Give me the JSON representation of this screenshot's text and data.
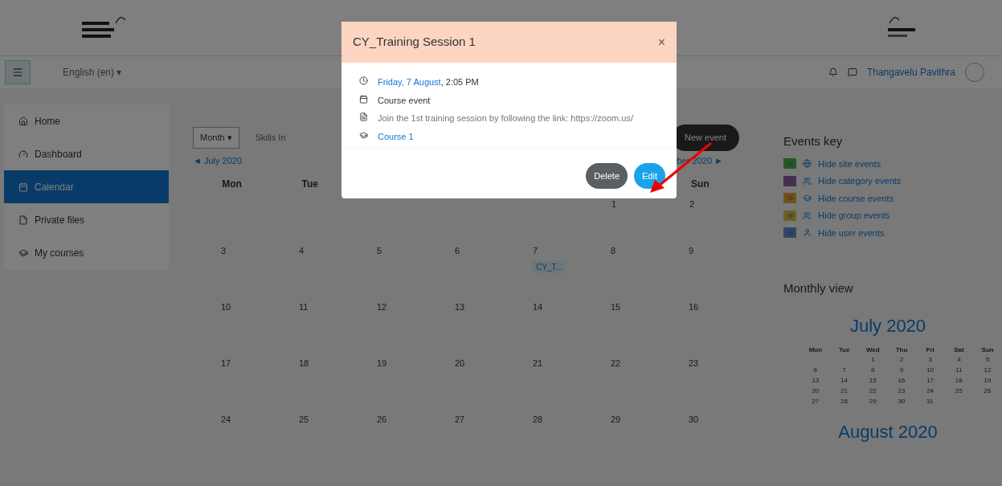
{
  "header": {
    "language": "English (en) ▾",
    "user_name": "Thangavelu Pavithra"
  },
  "sidebar": {
    "items": [
      {
        "label": "Home",
        "selected": false
      },
      {
        "label": "Dashboard",
        "selected": false
      },
      {
        "label": "Calendar",
        "selected": true
      },
      {
        "label": "Private files",
        "selected": false
      },
      {
        "label": "My courses",
        "selected": false
      }
    ]
  },
  "calendar": {
    "view_select": "Month ▾",
    "course_select": "Skills In",
    "prev_arrow": "◄",
    "prev_month": "July 2020",
    "next_month": "ber 2020",
    "next_arrow": "►",
    "new_event": "New event",
    "weekdays_left": [
      "Mon",
      "Tue"
    ],
    "weekdays_right": [
      "Sun"
    ],
    "weeks": [
      {
        "days": [
          {
            "day": "1"
          },
          {
            "day": "2"
          }
        ]
      },
      {
        "days": [
          {
            "day": "3"
          },
          {
            "day": "4"
          },
          {
            "day": "5"
          },
          {
            "day": "6"
          },
          {
            "day": "7",
            "event": "CY_T..."
          },
          {
            "day": "8"
          },
          {
            "day": "9"
          }
        ]
      },
      {
        "days": [
          {
            "day": "10"
          },
          {
            "day": "11"
          },
          {
            "day": "12"
          },
          {
            "day": "13"
          },
          {
            "day": "14"
          },
          {
            "day": "15"
          },
          {
            "day": "16"
          }
        ]
      },
      {
        "days": [
          {
            "day": "17"
          },
          {
            "day": "18"
          },
          {
            "day": "19"
          },
          {
            "day": "20"
          },
          {
            "day": "21"
          },
          {
            "day": "22"
          },
          {
            "day": "23"
          }
        ]
      },
      {
        "days": [
          {
            "day": "24"
          },
          {
            "day": "25"
          },
          {
            "day": "26"
          },
          {
            "day": "27"
          },
          {
            "day": "28"
          },
          {
            "day": "29"
          },
          {
            "day": "30"
          }
        ]
      }
    ]
  },
  "events_key": {
    "title": "Events key",
    "items": [
      {
        "label": "Hide site events",
        "color": "#265728"
      },
      {
        "label": "Hide category events",
        "color": "#472f51"
      },
      {
        "label": "Hide course events",
        "color": "#74511d"
      },
      {
        "label": "Hide group events",
        "color": "#6c6025"
      },
      {
        "label": "Hide user events",
        "color": "#2e4868"
      }
    ]
  },
  "monthly_view": {
    "title": "Monthly view",
    "month": "July 2020",
    "weekdays": [
      "Mon",
      "Tue",
      "Wed",
      "Thu",
      "Fri",
      "Sat",
      "Sun"
    ],
    "weeks": [
      {
        "days": [
          "1",
          "2",
          "3",
          "4",
          "5"
        ]
      },
      {
        "days": [
          "6",
          "7",
          "8",
          "9",
          "10",
          "11",
          "12"
        ]
      },
      {
        "days": [
          "13",
          "14",
          "15",
          "16",
          "17",
          "18",
          "19"
        ]
      },
      {
        "days": [
          "20",
          "21",
          "22",
          "23",
          "24",
          "25",
          "26"
        ]
      },
      {
        "days": [
          "27",
          "28",
          "29",
          "30",
          "31"
        ]
      }
    ],
    "next_month": "August 2020"
  },
  "modal": {
    "title": "CY_Training Session 1",
    "close": "×",
    "date_link": "Friday, 7 August",
    "time": ", 2:05 PM",
    "event_type": "Course event",
    "description": "Join the 1st training session by following the link: https://zoom.us/",
    "course": "Course 1",
    "buttons": [
      {
        "label": "Delete",
        "kind": "secondary"
      },
      {
        "label": "Edit",
        "kind": "primary"
      }
    ]
  }
}
